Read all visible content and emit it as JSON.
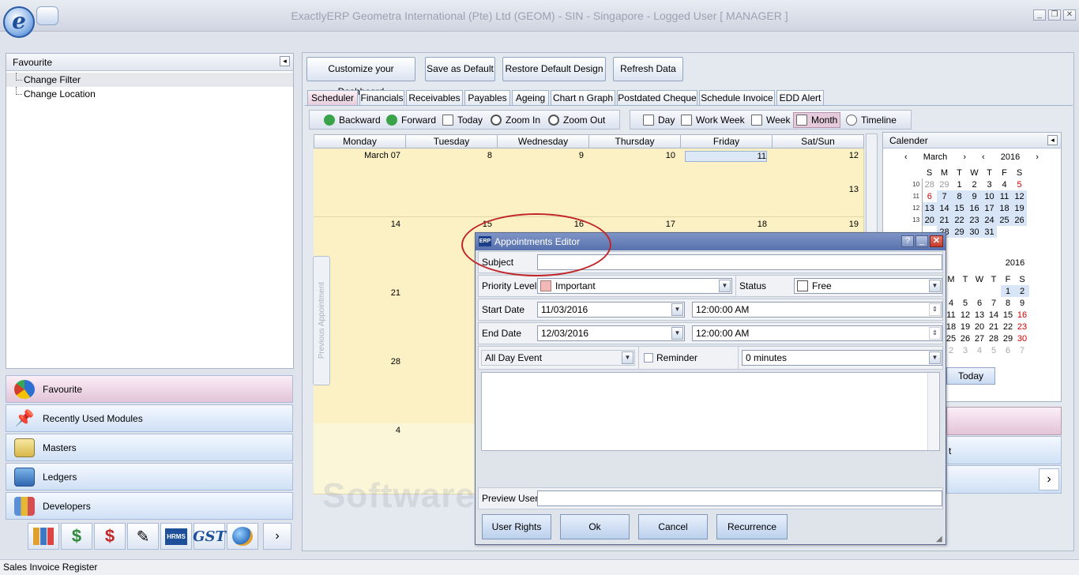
{
  "window": {
    "title": "ExactlyERP  Geometra International (Pte) Ltd (GEOM) - SIN - Singapore - Logged User [ MANAGER ]",
    "logo_letter": "e"
  },
  "favourite": {
    "header": "Favourite",
    "items": [
      "Change Filter",
      "Change Location"
    ]
  },
  "nav": {
    "buttons": [
      "Favourite",
      "Recently Used Modules",
      "Masters",
      "Ledgers",
      "Developers"
    ],
    "icons": [
      "chart-icon",
      "dollar-icon",
      "money-icon",
      "checklist-icon",
      "hrms-icon",
      "gst-icon",
      "globe-icon"
    ],
    "icon_text": {
      "hrms": "HRMS",
      "gst": "GST"
    },
    "more": "›"
  },
  "toolbar": {
    "buttons": [
      "Customize your Dashboard",
      "Save as Default",
      "Restore Default Design",
      "Refresh Data"
    ]
  },
  "tabs": [
    "Scheduler",
    "Financials",
    "Receivables",
    "Payables",
    "Ageing",
    "Chart n Graph",
    "Postdated Cheque",
    "Schedule Invoice",
    "EDD Alert"
  ],
  "scheduler": {
    "nav": [
      "Backward",
      "Forward",
      "Today",
      "Zoom In",
      "Zoom Out"
    ],
    "views": [
      "Day",
      "Work Week",
      "Week",
      "Month",
      "Timeline"
    ],
    "days": [
      "Monday",
      "Tuesday",
      "Wednesday",
      "Thursday",
      "Friday",
      "Sat/Sun"
    ],
    "week1": [
      "March 07",
      "8",
      "9",
      "10",
      "11",
      "12",
      "13"
    ],
    "week2": [
      "14",
      "15",
      "16",
      "17",
      "18",
      "19"
    ],
    "week3": [
      "21"
    ],
    "week4": [
      "28"
    ],
    "week5": [
      "4"
    ],
    "prev_appointment": "Previous Appointment"
  },
  "calendar": {
    "header": "Calender",
    "month1": {
      "month": "March",
      "year": "2016",
      "dow": [
        "S",
        "M",
        "T",
        "W",
        "T",
        "F",
        "S"
      ],
      "weeks": [
        {
          "wk": "10",
          "days": [
            "28",
            "29",
            "1",
            "2",
            "3",
            "4",
            "5"
          ]
        },
        {
          "wk": "11",
          "days": [
            "6",
            "7",
            "8",
            "9",
            "10",
            "11",
            "12"
          ]
        },
        {
          "wk": "12",
          "days": [
            "13",
            "14",
            "15",
            "16",
            "17",
            "18",
            "19"
          ]
        },
        {
          "wk": "13",
          "days": [
            "20",
            "21",
            "22",
            "23",
            "24",
            "25",
            "26"
          ]
        },
        {
          "wk": "",
          "days": [
            "",
            "28",
            "29",
            "30",
            "31",
            "",
            ""
          ]
        }
      ]
    },
    "month2": {
      "year": "2016",
      "dow": [
        "M",
        "T",
        "W",
        "T",
        "F",
        "S"
      ],
      "weeks": [
        [
          "",
          "",
          "",
          "",
          "1",
          "2"
        ],
        [
          "4",
          "5",
          "6",
          "7",
          "8",
          "9"
        ],
        [
          "11",
          "12",
          "13",
          "14",
          "15",
          "16"
        ],
        [
          "18",
          "19",
          "20",
          "21",
          "22",
          "23"
        ],
        [
          "25",
          "26",
          "27",
          "28",
          "29",
          "30"
        ],
        [
          "2",
          "3",
          "4",
          "5",
          "6",
          "7"
        ]
      ]
    },
    "today": "Today",
    "partial": "t"
  },
  "dialog": {
    "title": "Appointments Editor",
    "title_logo": "ERP",
    "subject_label": "Subject",
    "subject_value": "",
    "priority_label": "Priority Level",
    "priority_value": "Important",
    "status_label": "Status",
    "status_value": "Free",
    "start_label": "Start Date",
    "start_date": "11/03/2016",
    "start_time": "12:00:00 AM",
    "end_label": "End Date",
    "end_date": "12/03/2016",
    "end_time": "12:00:00 AM",
    "allday": "All Day Event",
    "reminder": "Reminder",
    "reminder_value": "0 minutes",
    "preview_label": "Preview User",
    "buttons": [
      "User Rights",
      "Ok",
      "Cancel",
      "Recurrence"
    ]
  },
  "statusbar": {
    "text": "Sales Invoice Register"
  },
  "watermark": "SoftwareSuggest.com",
  "colors": {
    "accent": "#5771ad",
    "highlight": "#cfe0f5",
    "cell": "#fbf1c4",
    "annotation": "#c0252a"
  }
}
